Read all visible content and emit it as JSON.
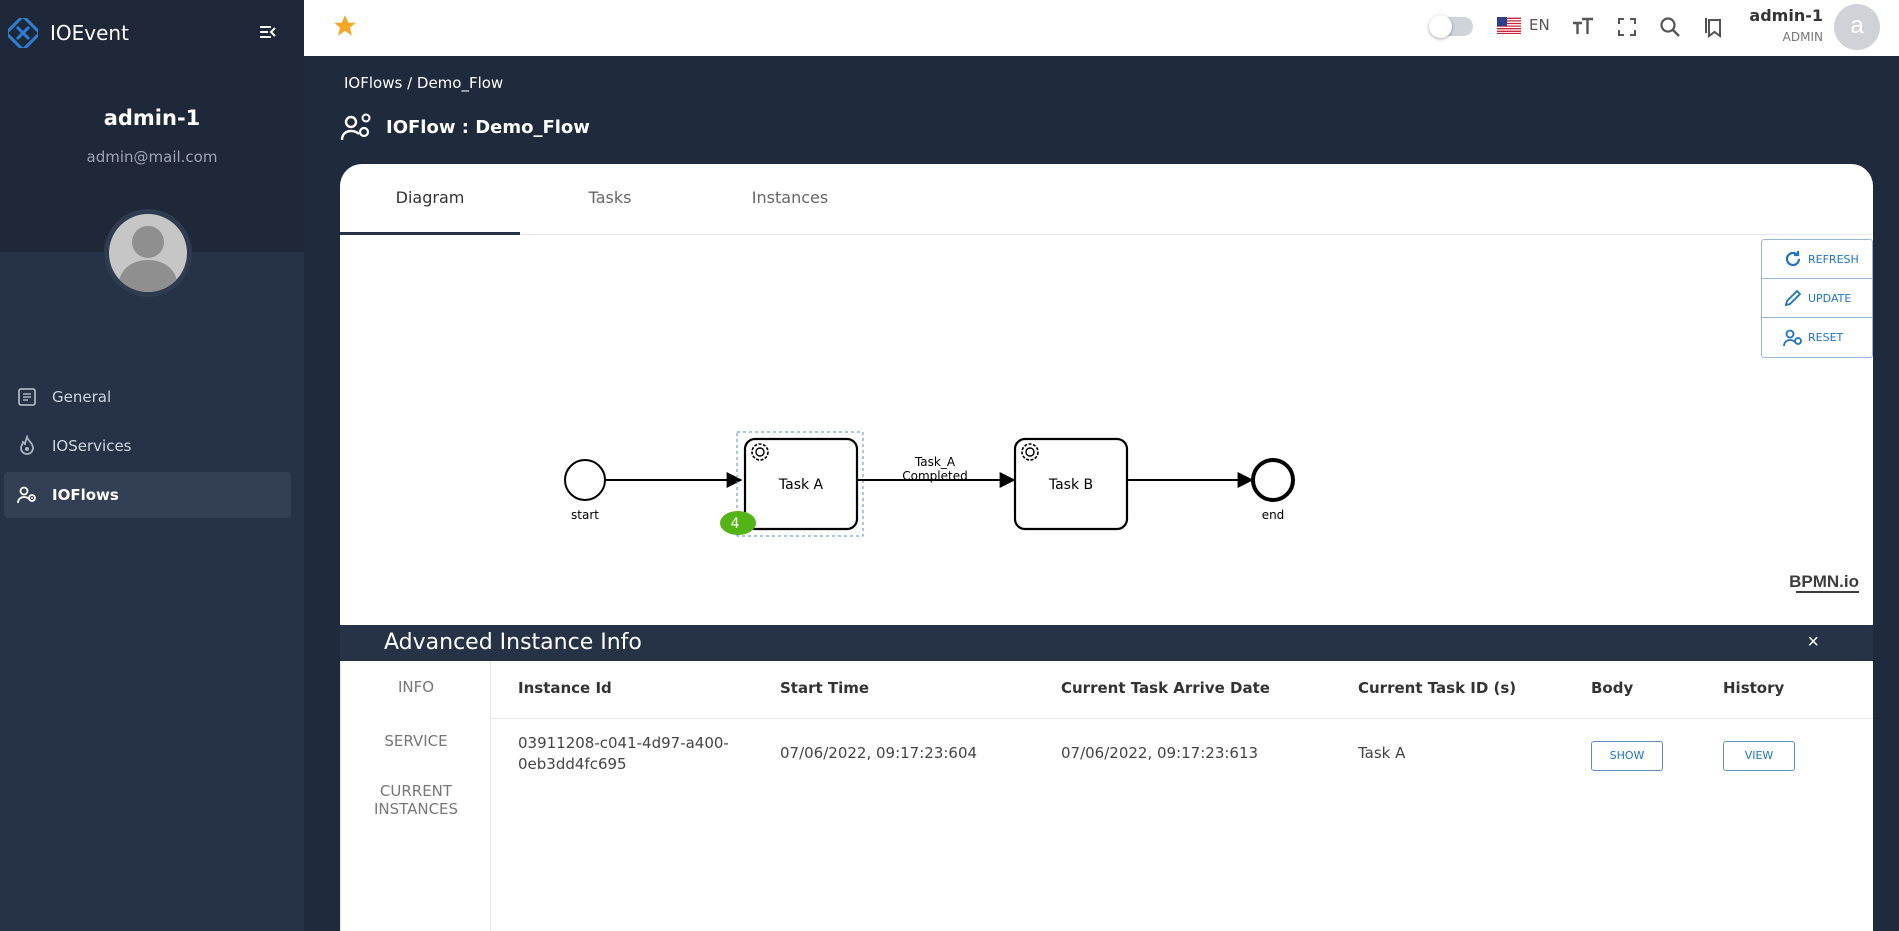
{
  "app": {
    "name": "IOEvent"
  },
  "profile": {
    "name": "admin-1",
    "email": "admin@mail.com"
  },
  "sidebar": {
    "items": [
      {
        "label": "General",
        "icon": "document-icon"
      },
      {
        "label": "IOServices",
        "icon": "fire-icon"
      },
      {
        "label": "IOFlows",
        "icon": "users-gear-icon",
        "active": true
      }
    ]
  },
  "topbar": {
    "language": "EN",
    "user": {
      "name": "admin-1",
      "role": "ADMIN",
      "initial": "a"
    }
  },
  "breadcrumb": {
    "parent": "IOFlows",
    "separator": " / ",
    "current": "Demo_Flow"
  },
  "page": {
    "title": "IOFlow : Demo_Flow"
  },
  "tabs": [
    {
      "label": "Diagram"
    },
    {
      "label": "Tasks"
    },
    {
      "label": "Instances"
    }
  ],
  "actions": {
    "refresh": "REFRESH",
    "update": "UPDATE",
    "reset": "RESET"
  },
  "diagram": {
    "start_label": "start",
    "end_label": "end",
    "task_a": "Task A",
    "task_b": "Task B",
    "flow_label_1": "Task_A",
    "flow_label_2": "Completed",
    "badge": "4",
    "watermark": "BPMN.io"
  },
  "advanced": {
    "title": "Advanced Instance Info",
    "close": "×",
    "side": [
      "INFO",
      "SERVICE",
      "CURRENT",
      "INSTANCES"
    ],
    "columns": [
      "Instance Id",
      "Start Time",
      "Current Task Arrive Date",
      "Current Task ID (s)",
      "Body",
      "History"
    ],
    "row": {
      "instance_id_1": "03911208-c041-4d97-a400-",
      "instance_id_2": "0eb3dd4fc695",
      "start_time": "07/06/2022, 09:17:23:604",
      "arrive_date": "07/06/2022, 09:17:23:613",
      "task_ids": "Task A",
      "body_button": "SHOW",
      "history_button": "VIEW"
    }
  },
  "colors": {
    "sidebar": "#263245",
    "accent": "#1e73c8",
    "badge": "#52b415",
    "star": "#f5a623"
  }
}
